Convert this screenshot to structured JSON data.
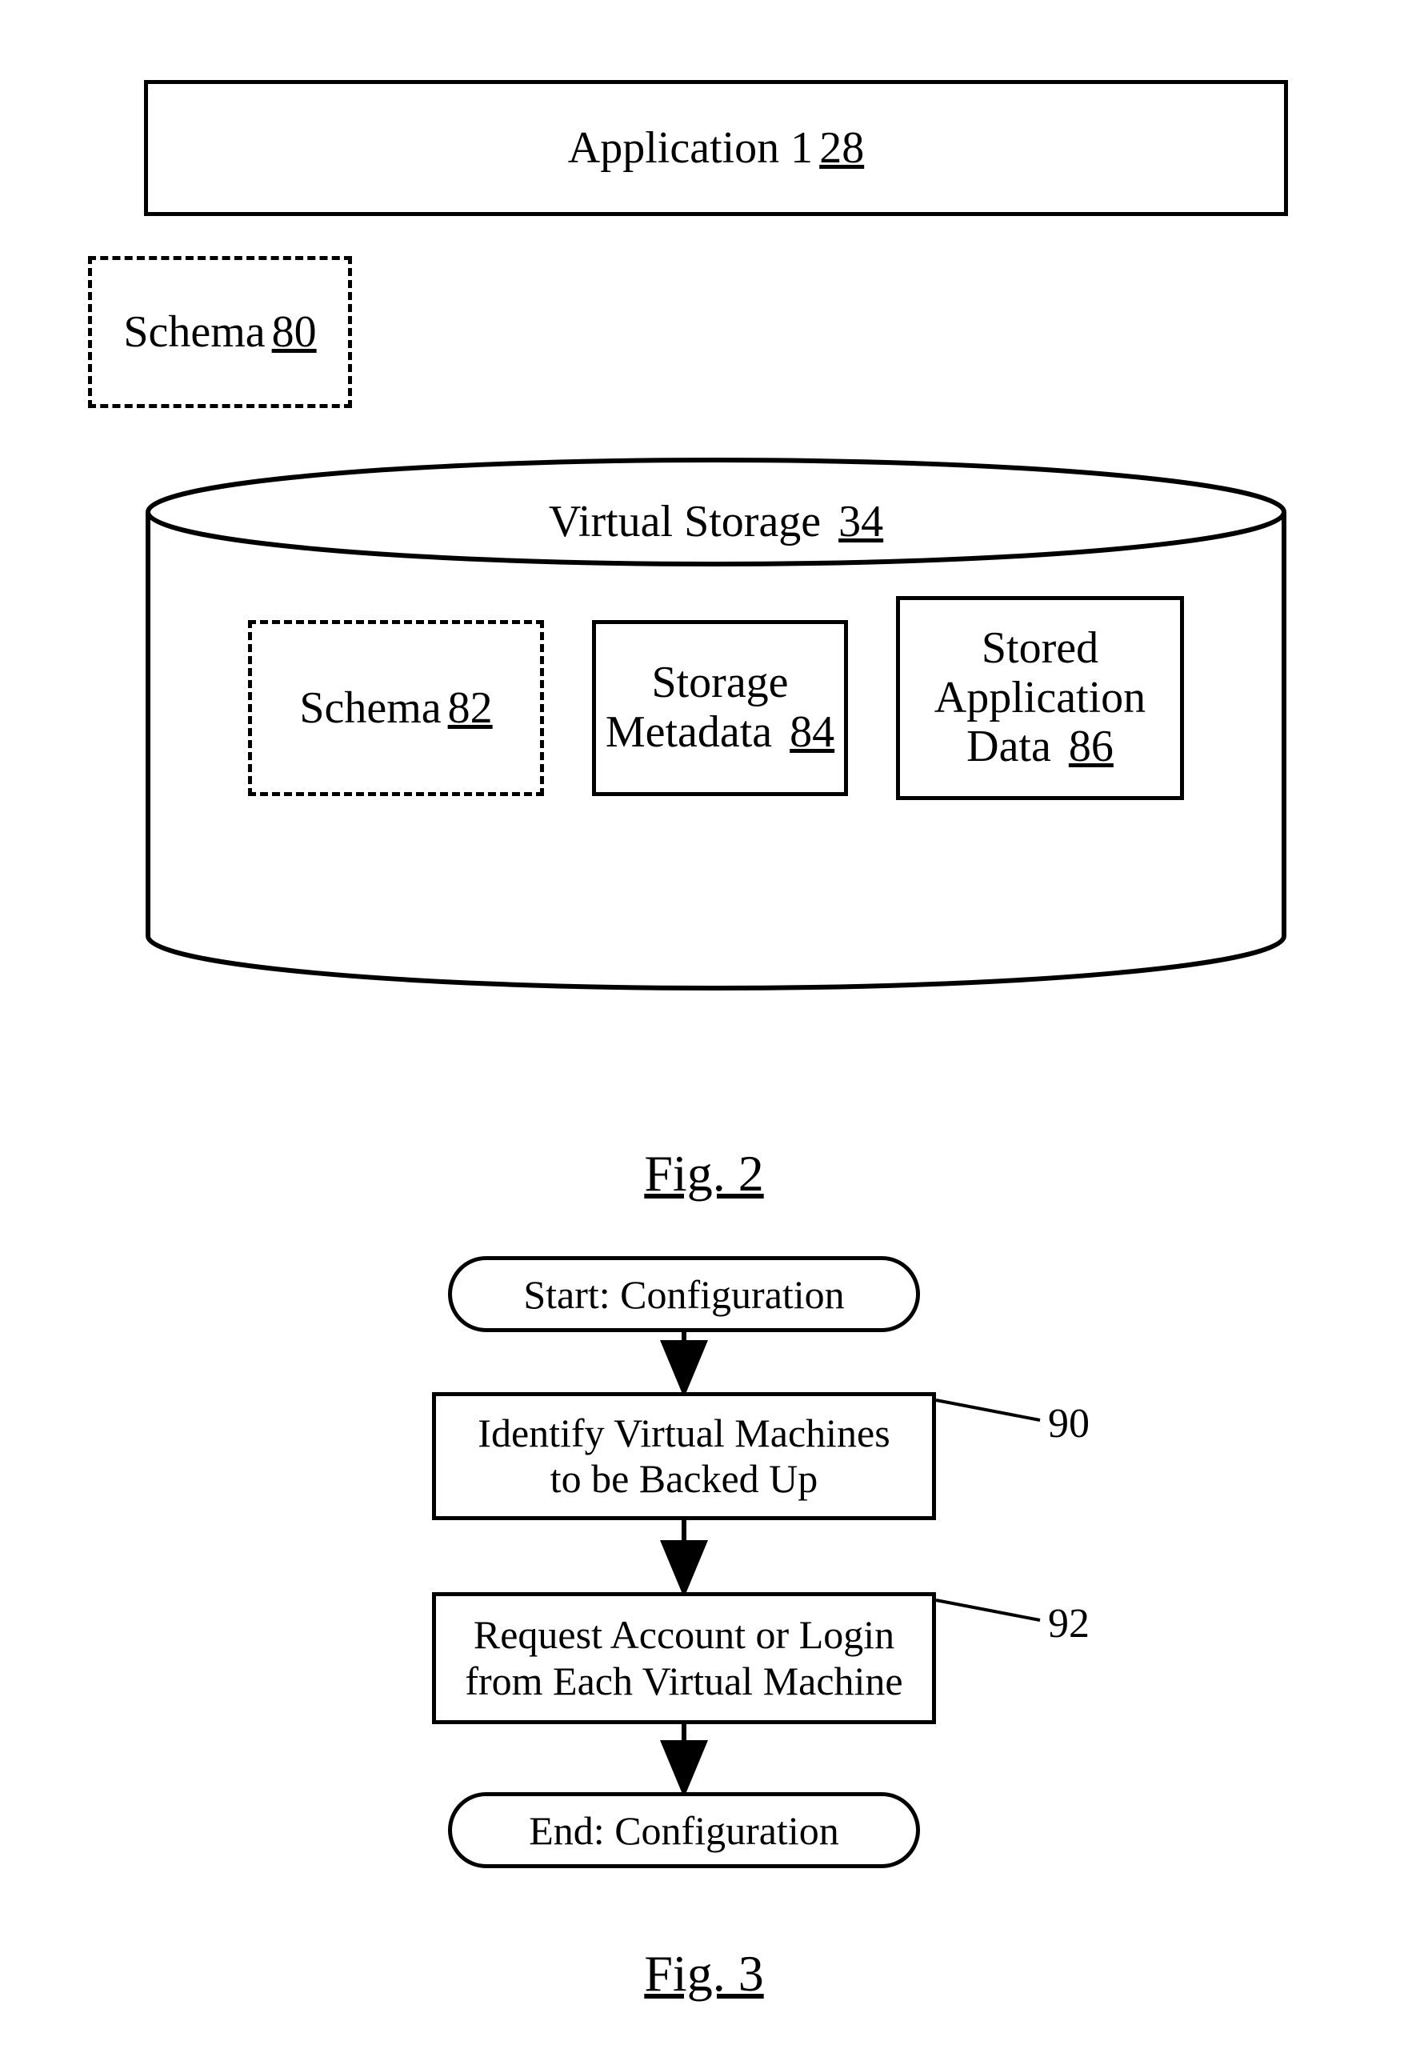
{
  "fig2": {
    "application": {
      "label": "Application 1",
      "ref": "28"
    },
    "schema_outer": {
      "label": "Schema",
      "ref": "80"
    },
    "cylinder": {
      "title": "Virtual Storage",
      "ref": "34",
      "schema_inner": {
        "label": "Schema",
        "ref": "82"
      },
      "storage_metadata": {
        "line1": "Storage",
        "line2": "Metadata",
        "ref": "84"
      },
      "stored_app_data": {
        "line1": "Stored",
        "line2": "Application",
        "line3": "Data",
        "ref": "86"
      }
    },
    "caption": "Fig. 2"
  },
  "fig3": {
    "start": "Start:  Configuration",
    "step1": {
      "line1": "Identify Virtual Machines",
      "line2": "to be Backed Up",
      "ref": "90"
    },
    "step2": {
      "line1": "Request Account or Login",
      "line2": "from Each Virtual Machine",
      "ref": "92"
    },
    "end": "End:  Configuration",
    "caption": "Fig. 3"
  }
}
